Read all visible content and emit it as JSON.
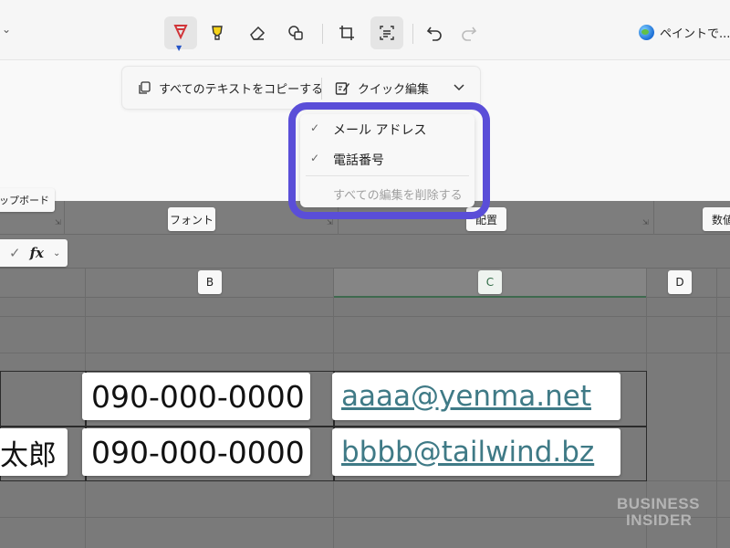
{
  "toolbar": {
    "paint_label": "ペイントで...",
    "tools": [
      "pen-icon",
      "highlighter-icon",
      "eraser-icon",
      "shapes-icon",
      "crop-icon",
      "text-actions-icon",
      "undo-icon",
      "redo-icon"
    ],
    "pen_color": "#d13438",
    "highlighter_color": "#f5d31a"
  },
  "action_bar": {
    "copy_all_text": "すべてのテキストをコピーする",
    "quick_edit": "クイック編集"
  },
  "dropdown": {
    "items": [
      {
        "label": "メール アドレス",
        "checked": true
      },
      {
        "label": "電話番号",
        "checked": true
      }
    ],
    "remove_all": "すべての編集を削除する",
    "highlight_color": "#5a4ed8"
  },
  "ribbon": {
    "groups": [
      "フォント",
      "配置",
      "数値"
    ],
    "partial_left": "クリップボード"
  },
  "formula_bar": {
    "fx": "fx"
  },
  "columns": [
    "B",
    "C",
    "D"
  ],
  "rows": [
    {
      "name": "",
      "phone": "090-000-0000",
      "email": "aaaa@yenma.net"
    },
    {
      "name": "太郎",
      "phone": "090-000-0000",
      "email": "bbbb@tailwind.bz"
    }
  ],
  "watermark": {
    "line1": "BUSINESS",
    "line2": "INSIDER"
  }
}
